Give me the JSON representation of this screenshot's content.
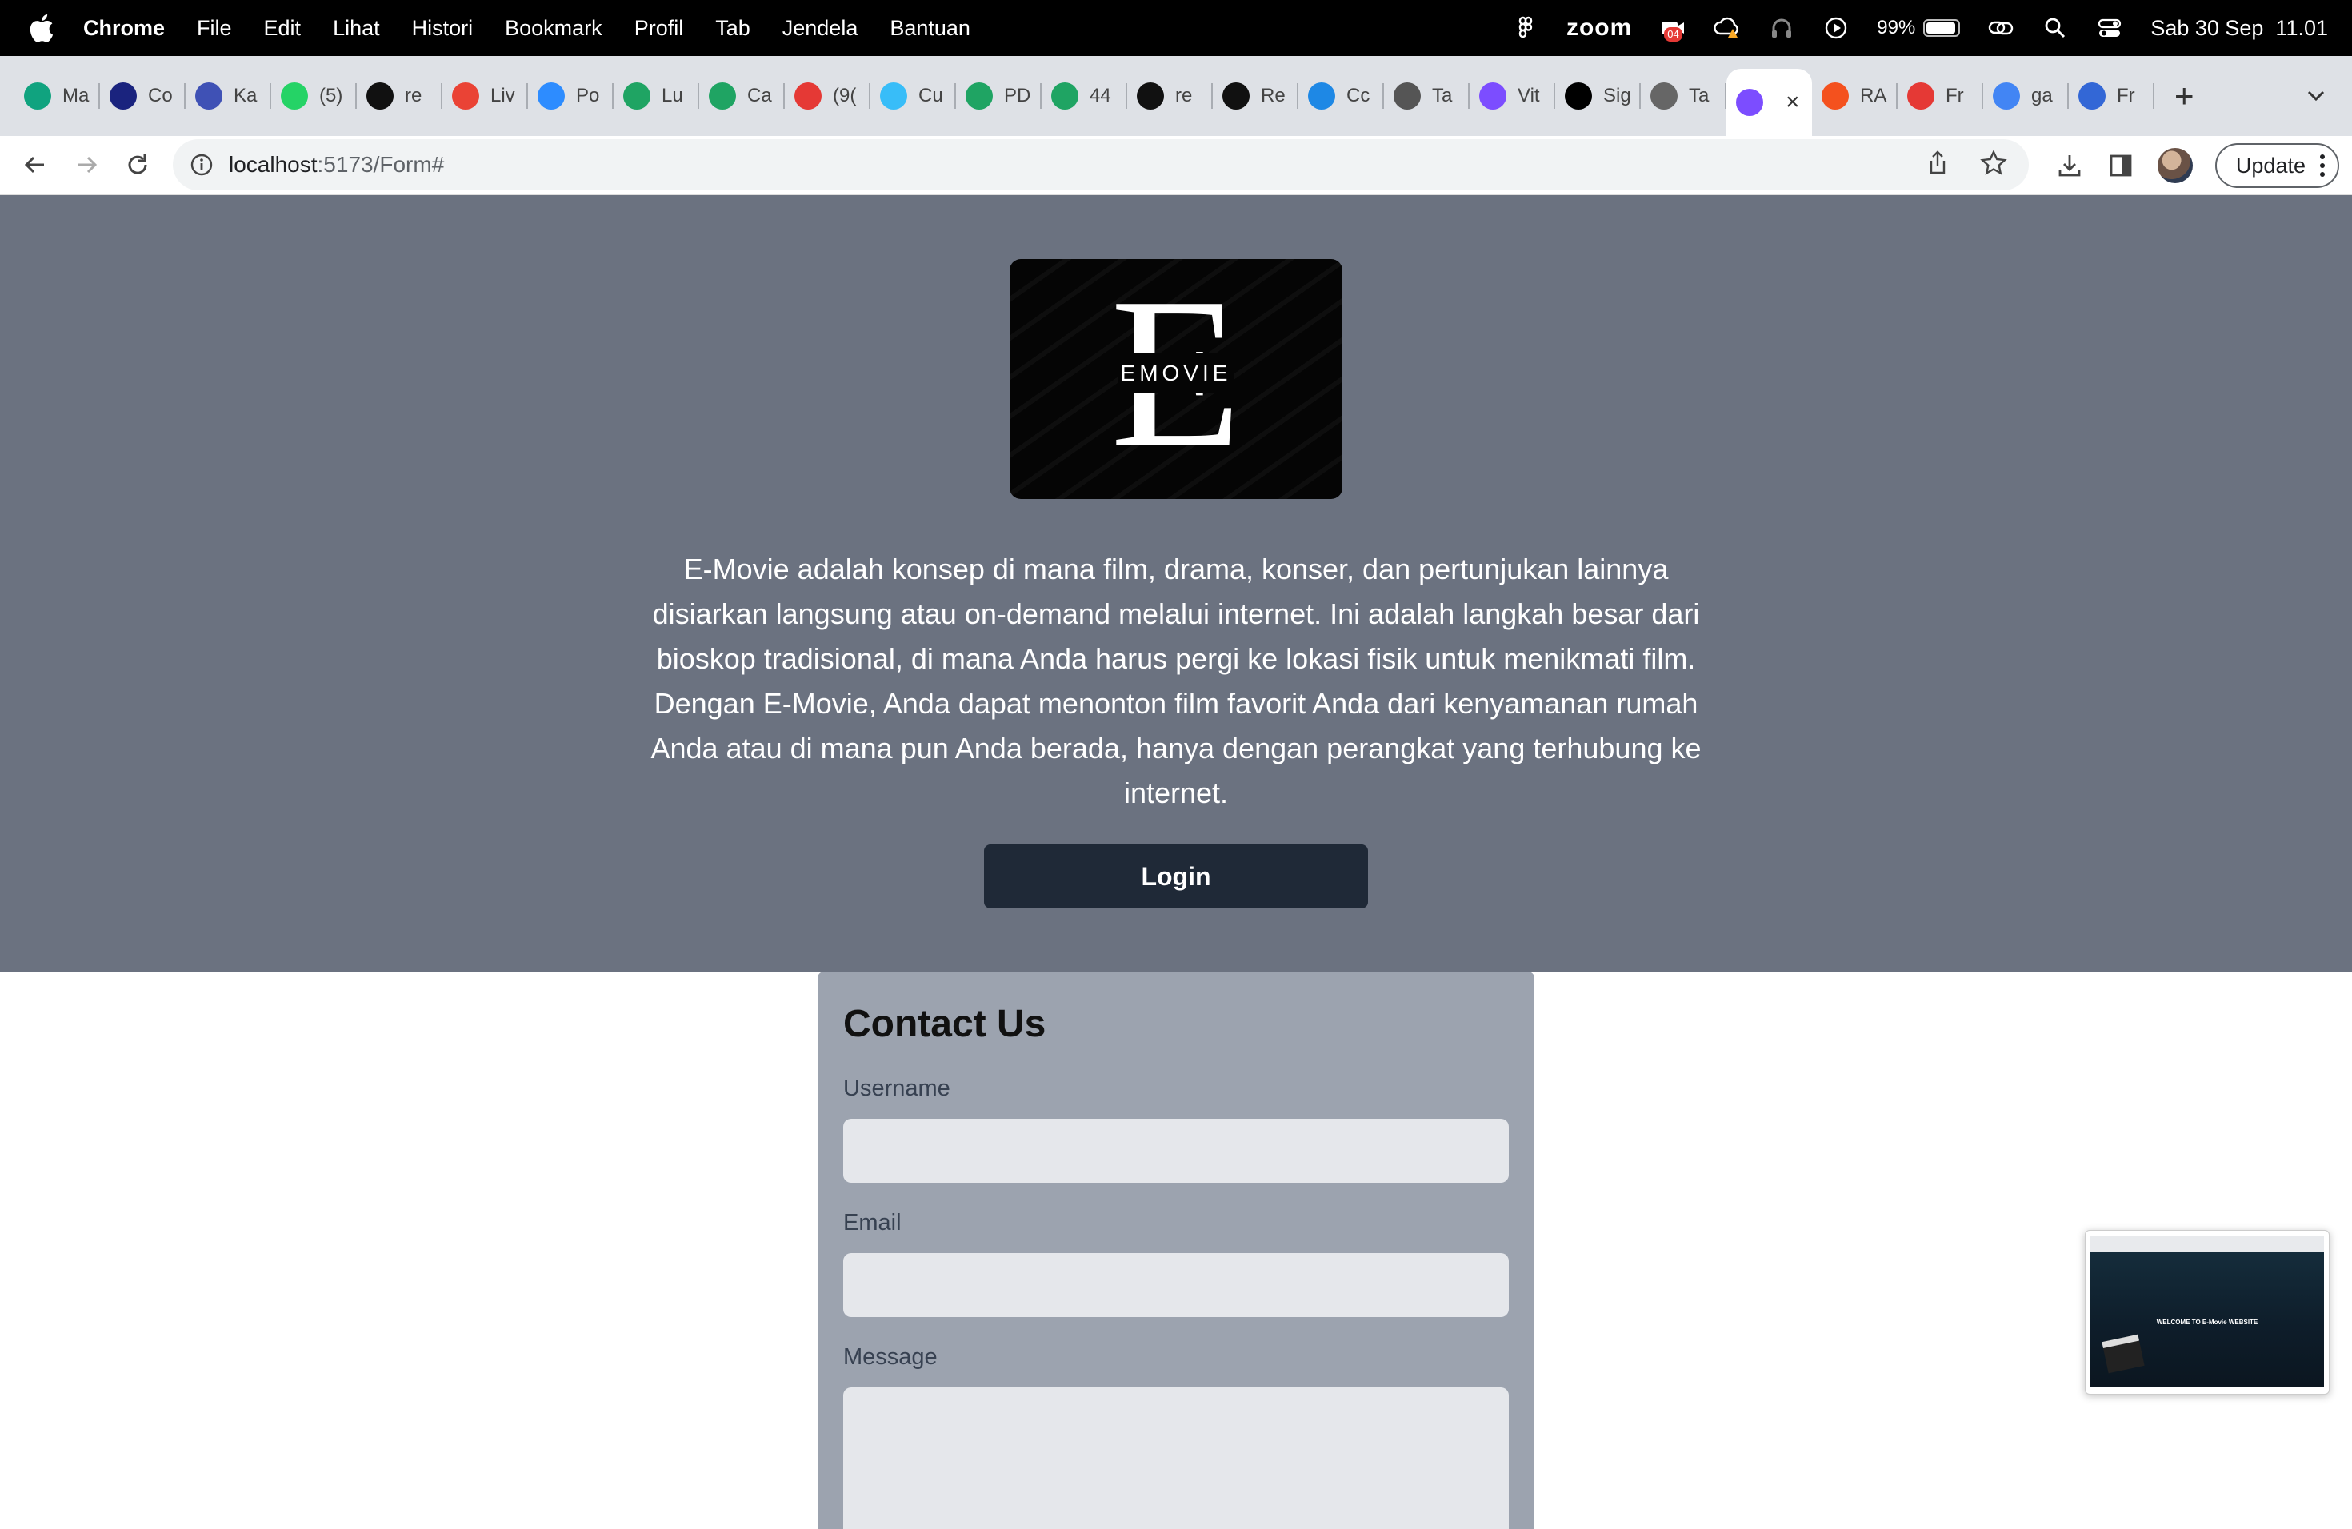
{
  "menubar": {
    "app_name": "Chrome",
    "menus": [
      "File",
      "Edit",
      "Lihat",
      "Histori",
      "Bookmark",
      "Profil",
      "Tab",
      "Jendela",
      "Bantuan"
    ],
    "zoom_label": "zoom",
    "zoom_badge": "04",
    "battery": "99%",
    "datetime": "Sab 30 Sep  11.01"
  },
  "tabs": [
    {
      "label": "Ma",
      "icon": "chatgpt-icon",
      "color": "#10a37f"
    },
    {
      "label": "Co",
      "icon": "one-icon",
      "color": "#1a237e"
    },
    {
      "label": "Ka",
      "icon": "kampus-icon",
      "color": "#3f51b5"
    },
    {
      "label": "(5)",
      "icon": "whatsapp-icon",
      "color": "#25d366"
    },
    {
      "label": "re",
      "icon": "github-icon",
      "color": "#111111"
    },
    {
      "label": "Liv",
      "icon": "gmail-icon",
      "color": "#ea4335"
    },
    {
      "label": "Po",
      "icon": "zoom-icon",
      "color": "#2d8cff"
    },
    {
      "label": "Lu",
      "icon": "drive-icon",
      "color": "#1fa463"
    },
    {
      "label": "Ca",
      "icon": "drive-icon",
      "color": "#1fa463"
    },
    {
      "label": "(9(",
      "icon": "badge-909-icon",
      "color": "#e53935"
    },
    {
      "label": "Cu",
      "icon": "tailwind-icon",
      "color": "#38bdf8"
    },
    {
      "label": "PD",
      "icon": "drive-icon",
      "color": "#1fa463"
    },
    {
      "label": "44",
      "icon": "drive-icon",
      "color": "#1fa463"
    },
    {
      "label": "re",
      "icon": "github-icon",
      "color": "#111111"
    },
    {
      "label": "Re",
      "icon": "github-icon",
      "color": "#111111"
    },
    {
      "label": "Cc",
      "icon": "react-icon",
      "color": "#1e88e5"
    },
    {
      "label": "Ta",
      "icon": "chrome-icon",
      "color": "#555555"
    },
    {
      "label": "Vit",
      "icon": "vite-icon",
      "color": "#7c4dff"
    },
    {
      "label": "Sig",
      "icon": "vercel-icon",
      "color": "#000000"
    },
    {
      "label": "Ta",
      "icon": "globe-icon",
      "color": "#666666"
    },
    {
      "label": "",
      "icon": "vite-icon",
      "color": "#7c4dff",
      "active": true
    },
    {
      "label": "RA",
      "icon": "wallet-icon",
      "color": "#f4511e"
    },
    {
      "label": "Fr",
      "icon": "s-icon",
      "color": "#e53935"
    },
    {
      "label": "ga",
      "icon": "google-icon",
      "color": "#4285f4"
    },
    {
      "label": "Fr",
      "icon": "forms-icon",
      "color": "#3367d6"
    }
  ],
  "toolbar": {
    "url_host": "localhost",
    "url_rest": ":5173/Form#",
    "update_label": "Update"
  },
  "hero": {
    "logo_letter": "E",
    "logo_text": "EMOVIE",
    "description": "E-Movie adalah konsep di mana film, drama, konser, dan pertunjukan lainnya disiarkan langsung atau on-demand melalui internet. Ini adalah langkah besar dari bioskop tradisional, di mana Anda harus pergi ke lokasi fisik untuk menikmati film. Dengan E-Movie, Anda dapat menonton film favorit Anda dari kenyamanan rumah Anda atau di mana pun Anda berada, hanya dengan perangkat yang terhubung ke internet.",
    "login_label": "Login"
  },
  "contact": {
    "title": "Contact Us",
    "username_label": "Username",
    "username_value": "",
    "email_label": "Email",
    "email_value": "",
    "message_label": "Message",
    "message_value": ""
  },
  "pip": {
    "title": "WELCOME TO E-Movie WEBSITE"
  },
  "colors": {
    "hero_bg": "#6b7280",
    "button_bg": "#1f2937",
    "card_bg": "#9ca3af",
    "input_bg": "#e5e7eb"
  }
}
